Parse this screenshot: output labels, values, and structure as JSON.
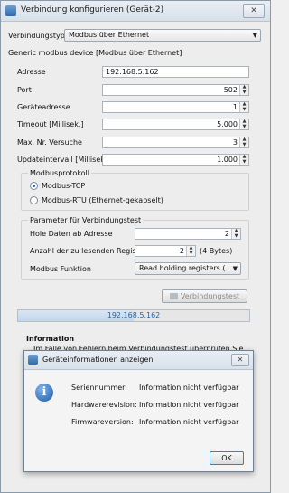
{
  "window": {
    "title": "Verbindung konfigurieren (Gerät-2)",
    "close_glyph": "✕"
  },
  "connection_type": {
    "label": "Verbindungstyp",
    "value": "Modbus über Ethernet"
  },
  "device_description": "Generic modbus device [Modbus über Ethernet]",
  "fields": {
    "address": {
      "label": "Adresse",
      "value": "192.168.5.162"
    },
    "port": {
      "label": "Port",
      "value": "502"
    },
    "device_address": {
      "label": "Geräteadresse",
      "value": "1"
    },
    "timeout": {
      "label": "Timeout [Millisek.]",
      "value": "5.000"
    },
    "max_attempts": {
      "label": "Max. Nr. Versuche",
      "value": "3"
    },
    "update_interval": {
      "label": "Updateintervall [Millisek.]",
      "value": "1.000"
    }
  },
  "protocol": {
    "title": "Modbusprotokoll",
    "options": [
      {
        "label": "Modbus-TCP",
        "selected": true
      },
      {
        "label": "Modbus-RTU (Ethernet-gekapselt)",
        "selected": false
      }
    ]
  },
  "test_params": {
    "title": "Parameter für Verbindungstest",
    "fetch_from_address": {
      "label": "Hole Daten ab Adresse",
      "value": "2"
    },
    "register_count": {
      "label": "Anzahl der zu lesenden Register",
      "value": "2",
      "suffix": "(4 Bytes)"
    },
    "function": {
      "label": "Modbus Funktion",
      "value": "Read holding registers (…"
    }
  },
  "test_button": {
    "label": "Verbindungstest"
  },
  "progress": {
    "text": "192.168.5.162",
    "fraction": 0.5
  },
  "information": {
    "heading": "Information",
    "text": "Im Falle von Fehlern beim Verbindungstest überprüfen Sie"
  },
  "dialog": {
    "title": "Geräteinformationen anzeigen",
    "close_glyph": "✕",
    "rows": [
      {
        "label": "Seriennummer:",
        "value": "Information nicht verfügbar"
      },
      {
        "label": "Hardwarerevision:",
        "value": "Information nicht verfügbar"
      },
      {
        "label": "Firmwareversion:",
        "value": "Information nicht verfügbar"
      }
    ],
    "ok_label": "OK",
    "icon_glyph": "i"
  },
  "icons": {
    "spin_up": "▲",
    "spin_down": "▼",
    "dropdown": "▼"
  }
}
